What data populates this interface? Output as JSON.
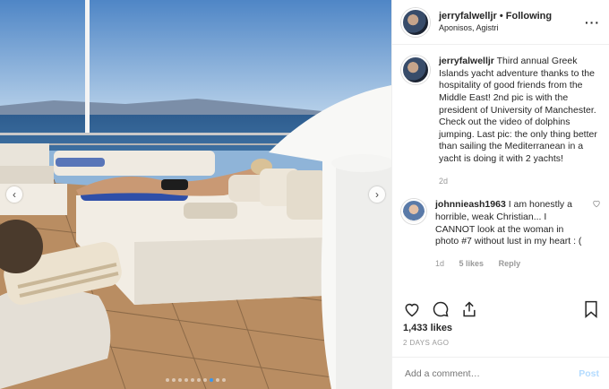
{
  "post": {
    "username": "jerryfalwelljr",
    "follow_sep": " • ",
    "follow_status": "Following",
    "location": "Aponisos, Agistri",
    "caption_username": "jerryfalwelljr",
    "caption_text": "Third annual Greek Islands yacht adventure thanks to the hospitality of good friends from the Middle East! 2nd pic is with the president of University of Manchester. Check out the video of dolphins jumping. Last pic: the only thing better than sailing the Mediterranean in a yacht is doing it with 2 yachts!",
    "caption_age": "2d",
    "likes": "1,433 likes",
    "time_ago": "2 DAYS AGO"
  },
  "comment": {
    "username": "johnnieash1963",
    "text": "I am honestly a horrible, weak Christian... I CANNOT look at the woman in photo #7 without lust in my heart : (",
    "age": "1d",
    "likes": "5 likes",
    "reply": "Reply"
  },
  "add_comment": {
    "placeholder": "Add a comment…",
    "post_label": "Post"
  },
  "icons": [
    "more-icon",
    "heart-icon",
    "comment-icon",
    "share-icon",
    "bookmark-icon",
    "chevron-left-icon",
    "chevron-right-icon"
  ],
  "colors": {
    "accent": "#3897f0",
    "post_disabled": "#b3dbff",
    "muted": "#999999"
  },
  "carousel": {
    "slides": 10,
    "active": 8
  }
}
